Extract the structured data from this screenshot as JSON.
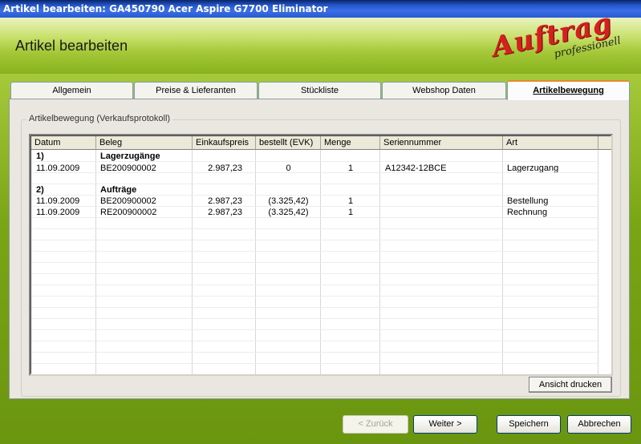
{
  "window": {
    "title": "Artikel bearbeiten: GA450790 Acer Aspire G7700 Eliminator"
  },
  "header": {
    "heading": "Artikel bearbeiten",
    "logo_word": "Auftrag",
    "logo_sub": "professionell"
  },
  "tabs": [
    {
      "label": "Allgemein"
    },
    {
      "label": "Preise & Lieferanten"
    },
    {
      "label": "Stückliste"
    },
    {
      "label": "Webshop Daten"
    },
    {
      "label": "Artikelbewegung",
      "active": true
    }
  ],
  "group": {
    "label": "Artikelbewegung (Verkaufsprotokoll)"
  },
  "table": {
    "columns": [
      "Datum",
      "Beleg",
      "Einkaufspreis",
      "bestellt (EVK)",
      "Menge",
      "Seriennummer",
      "Art"
    ],
    "rows": [
      {
        "datum": "1)",
        "beleg": "Lagerzugänge",
        "ek": "",
        "bestellt": "",
        "menge": "",
        "serien": "",
        "art": "",
        "bold": true
      },
      {
        "datum": "11.09.2009",
        "beleg": "BE200900002",
        "ek": "2.987,23",
        "bestellt": "0",
        "menge": "1",
        "serien": "A12342-12BCE",
        "art": "Lagerzugang"
      },
      {
        "datum": "",
        "beleg": "",
        "ek": "",
        "bestellt": "",
        "menge": "",
        "serien": "",
        "art": ""
      },
      {
        "datum": "2)",
        "beleg": "Aufträge",
        "ek": "",
        "bestellt": "",
        "menge": "",
        "serien": "",
        "art": "",
        "bold": true
      },
      {
        "datum": "11.09.2009",
        "beleg": "BE200900002",
        "ek": "2.987,23",
        "bestellt": "(3.325,42)",
        "menge": "1",
        "serien": "",
        "art": "Bestellung"
      },
      {
        "datum": "11.09.2009",
        "beleg": "RE200900002",
        "ek": "2.987,23",
        "bestellt": "(3.325,42)",
        "menge": "1",
        "serien": "",
        "art": "Rechnung"
      }
    ]
  },
  "buttons": {
    "print": "Ansicht drucken",
    "back": "< Zurück",
    "next": "Weiter >",
    "save": "Speichern",
    "cancel": "Abbrechen"
  }
}
